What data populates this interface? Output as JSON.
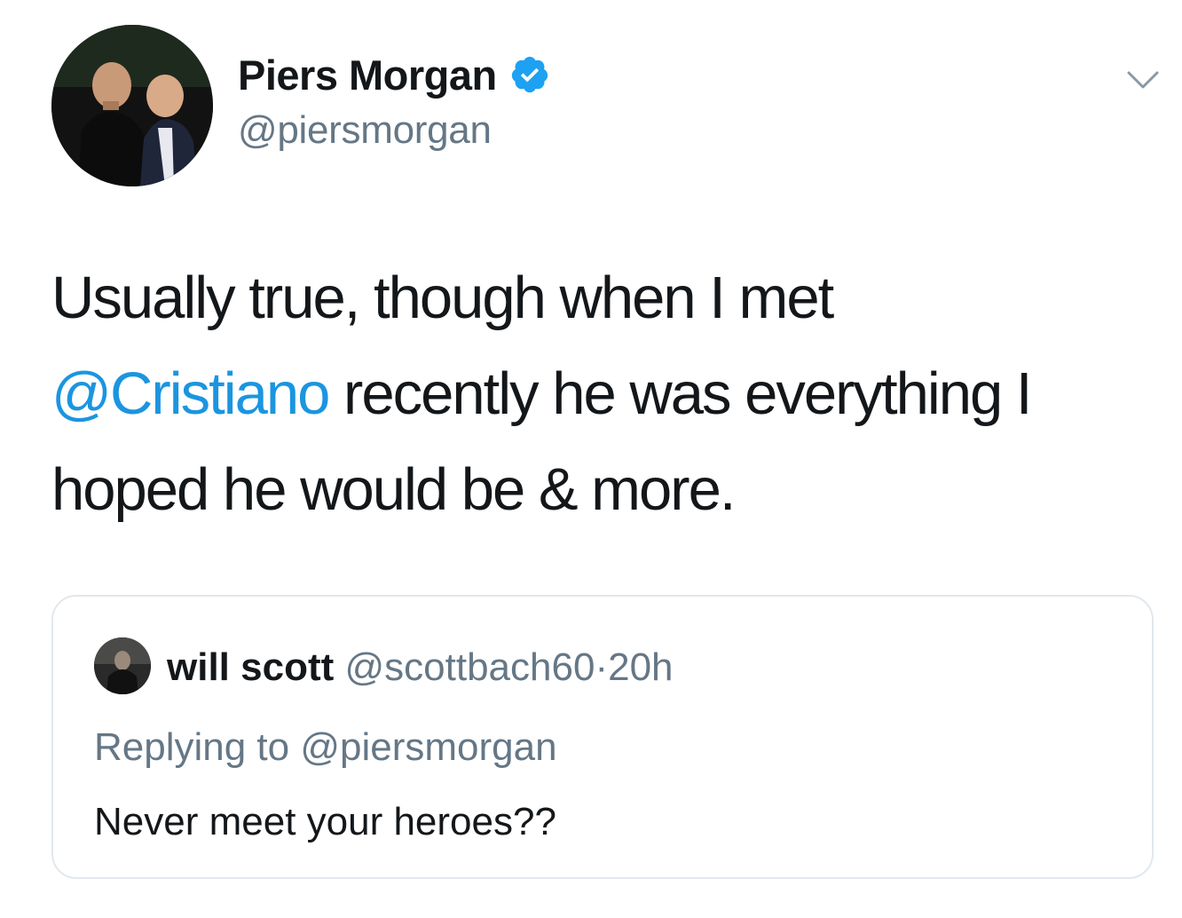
{
  "tweet": {
    "author": {
      "name": "Piers Morgan",
      "handle": "@piersmorgan",
      "verified": true,
      "avatar_icon": "profile-photo"
    },
    "menu_icon": "chevron-down-icon",
    "text": {
      "line1": "Usually true, though when I met",
      "mention": "@Cristiano",
      "line2_rest": " recently he was everything I",
      "line3": "hoped he would be & more."
    },
    "colors": {
      "text": "#14171a",
      "secondary": "#657786",
      "link": "#1b95e0",
      "verified": "#1da1f2",
      "border": "#e1e8ed"
    }
  },
  "quoted_tweet": {
    "name": "will scott",
    "handle": "@scottbach60",
    "separator": "·",
    "time": "20h",
    "replying_to": "Replying to @piersmorgan",
    "text": "Never meet your heroes??"
  }
}
